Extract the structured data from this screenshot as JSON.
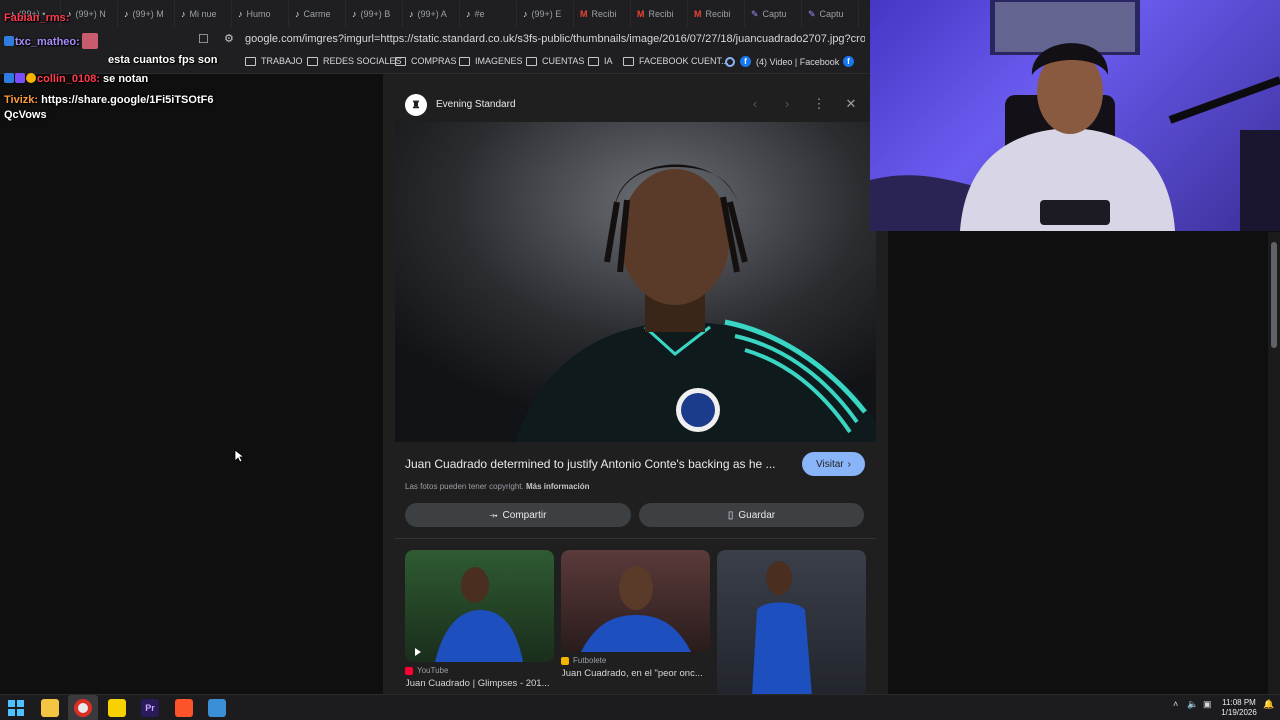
{
  "browser": {
    "tabs": [
      {
        "label": "(99+) •",
        "icon": "tiktok"
      },
      {
        "label": "(99+) N",
        "icon": "tiktok"
      },
      {
        "label": "(99+) M",
        "icon": "tiktok"
      },
      {
        "label": "Mi nue",
        "icon": "tiktok"
      },
      {
        "label": "Humo",
        "icon": "tiktok"
      },
      {
        "label": "Carme",
        "icon": "tiktok"
      },
      {
        "label": "(99+) B",
        "icon": "tiktok"
      },
      {
        "label": "(99+) A",
        "icon": "tiktok"
      },
      {
        "label": "#e",
        "icon": "tiktok"
      },
      {
        "label": "(99+) E",
        "icon": "tiktok"
      },
      {
        "label": "Recibi",
        "icon": "gmail"
      },
      {
        "label": "Recibi",
        "icon": "gmail"
      },
      {
        "label": "Recibi",
        "icon": "gmail"
      },
      {
        "label": "Captu",
        "icon": "pen"
      },
      {
        "label": "Captu",
        "icon": "pen"
      }
    ],
    "url": "google.com/imgres?imgurl=https://static.standard.co.uk/s3fs-public/thumbnails/image/2016/07/27/18/juancuadrado2707.jpg?crop%3D8:5,smart%2...",
    "bookmarks": [
      "TRABAJO",
      "REDES SOCIALES",
      "COMPRAS",
      "IMAGENES",
      "CUENTAS",
      "IA",
      "FACEBOOK CUENT...",
      "(4) Video | Facebook"
    ]
  },
  "chat": {
    "lines": [
      {
        "user": "Fabian_rms:",
        "text": ""
      },
      {
        "user": "txc_matheo:",
        "text": ""
      },
      {
        "user": "",
        "text": "esta cuantos fps son"
      },
      {
        "user": "collin_0108:",
        "text": "se notan"
      },
      {
        "user": "Tivizk:",
        "text": "https://share.google/1Fi5iTSOtF6"
      },
      {
        "user": "",
        "text": "QcVows"
      }
    ]
  },
  "viewer": {
    "source_name": "Evening Standard",
    "caption": "Juan Cuadrado determined to justify Antonio Conte's backing as he ...",
    "visit_label": "Visitar",
    "copyright_text": "Las fotos pueden tener copyright.",
    "more_info": "Más información",
    "share_label": "Compartir",
    "save_label": "Guardar",
    "related": [
      {
        "source": "YouTube",
        "title": "Juan Cuadrado | Glimpses - 201..."
      },
      {
        "source": "Futbolete",
        "title": "Juan Cuadrado, en el \"peor onc..."
      },
      {
        "source": "",
        "title": ""
      }
    ]
  },
  "taskbar": {
    "time": "11:08 PM",
    "date": "1/19/2026"
  }
}
